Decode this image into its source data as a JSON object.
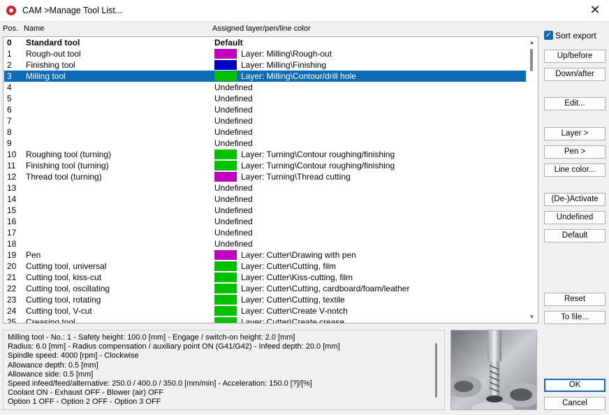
{
  "window": {
    "title": "CAM >Manage Tool List...",
    "close_glyph": "✕"
  },
  "columns": {
    "pos": "Pos.",
    "name": "Name",
    "assign": "Assigned layer/pen/line color"
  },
  "rows": [
    {
      "pos": "0",
      "name": "Standard tool",
      "assign": "Default",
      "color": null,
      "bold": true
    },
    {
      "pos": "1",
      "name": "Rough-out tool",
      "assign": "Layer: Milling\\Rough-out",
      "color": "#c000c0"
    },
    {
      "pos": "2",
      "name": "Finishing tool",
      "assign": "Layer: Milling\\Finishing",
      "color": "#0000c0"
    },
    {
      "pos": "3",
      "name": "Milling tool",
      "assign": "Layer: Milling\\Contour/drill hole",
      "color": "#00c000",
      "selected": true
    },
    {
      "pos": "4",
      "name": "",
      "assign": "Undefined",
      "color": null
    },
    {
      "pos": "5",
      "name": "",
      "assign": "Undefined",
      "color": null
    },
    {
      "pos": "6",
      "name": "",
      "assign": "Undefined",
      "color": null
    },
    {
      "pos": "7",
      "name": "",
      "assign": "Undefined",
      "color": null
    },
    {
      "pos": "8",
      "name": "",
      "assign": "Undefined",
      "color": null
    },
    {
      "pos": "9",
      "name": "",
      "assign": "Undefined",
      "color": null
    },
    {
      "pos": "10",
      "name": "Roughing tool (turning)",
      "assign": "Layer: Turning\\Contour roughing/finishing",
      "color": "#00c000"
    },
    {
      "pos": "11",
      "name": "Finishing tool (turning)",
      "assign": "Layer: Turning\\Contour roughing/finishing",
      "color": "#00c000"
    },
    {
      "pos": "12",
      "name": "Thread tool (turning)",
      "assign": "Layer: Turning\\Thread cutting",
      "color": "#c000c0"
    },
    {
      "pos": "13",
      "name": "",
      "assign": "Undefined",
      "color": null
    },
    {
      "pos": "14",
      "name": "",
      "assign": "Undefined",
      "color": null
    },
    {
      "pos": "15",
      "name": "",
      "assign": "Undefined",
      "color": null
    },
    {
      "pos": "16",
      "name": "",
      "assign": "Undefined",
      "color": null
    },
    {
      "pos": "17",
      "name": "",
      "assign": "Undefined",
      "color": null
    },
    {
      "pos": "18",
      "name": "",
      "assign": "Undefined",
      "color": null
    },
    {
      "pos": "19",
      "name": "Pen",
      "assign": "Layer: Cutter\\Drawing with pen",
      "color": "#c000c0"
    },
    {
      "pos": "20",
      "name": "Cutting tool, universal",
      "assign": "Layer: Cutter\\Cutting, film",
      "color": "#00c000"
    },
    {
      "pos": "21",
      "name": "Cutting tool, kiss-cut",
      "assign": "Layer: Cutter\\Kiss-cutting, film",
      "color": "#00c000"
    },
    {
      "pos": "22",
      "name": "Cutting tool, oscillating",
      "assign": "Layer: Cutter\\Cutting, cardboard/foam/leather",
      "color": "#00c000"
    },
    {
      "pos": "23",
      "name": "Cutting tool, rotating",
      "assign": "Layer: Cutter\\Cutting, textile",
      "color": "#00c000"
    },
    {
      "pos": "24",
      "name": "Cutting tool, V-cut",
      "assign": "Layer: Cutter\\Create V-notch",
      "color": "#00c000"
    },
    {
      "pos": "25",
      "name": "Creasing tool",
      "assign": "Layer: Cutter\\Create crease",
      "color": "#00c000"
    }
  ],
  "info_lines": [
    "Milling tool  -  No.: 1  -  Safety height: 100.0 [mm]  -  Engage / switch-on height: 2.0 [mm]",
    "Radius: 6.0 [mm]  -  Radius compensation / auxiliary point ON (G41/G42)  -  Infeed depth: 20.0 [mm]",
    "Spindle speed: 4000 [rpm]  -  Clockwise",
    "Allowance depth: 0.5 [mm]",
    "Allowance side: 0.5 [mm]",
    "Speed infeed/feed/alternative: 250.0 / 400.0 / 350.0 [mm/min]  -  Acceleration: 150.0 [?]/[%]",
    "Coolant ON - Exhaust OFF - Blower (air) OFF",
    "Option 1 OFF - Option 2 OFF - Option 3 OFF"
  ],
  "sidebar": {
    "sort_export_label": "Sort export",
    "sort_export_checked": true,
    "buttons": {
      "up": "Up/before",
      "down": "Down/after",
      "edit": "Edit...",
      "layer": "Layer >",
      "pen": "Pen >",
      "line_color": "Line color...",
      "activate": "(De-)Activate",
      "undefined": "Undefined",
      "default": "Default",
      "reset": "Reset",
      "to_file": "To file...",
      "ok": "OK",
      "cancel": "Cancel"
    }
  }
}
